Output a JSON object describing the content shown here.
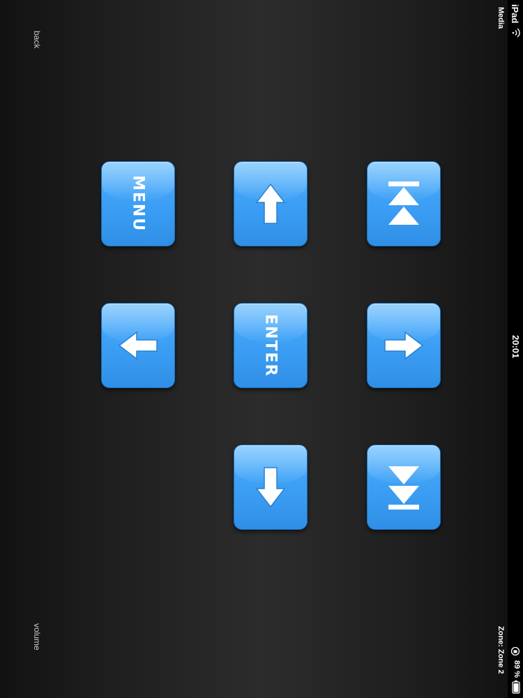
{
  "status_bar": {
    "device": "iPad",
    "time": "20:01",
    "battery": "89 %"
  },
  "header": {
    "title": "Media",
    "zone": "Zone: Zone 2"
  },
  "nav": {
    "back": "back",
    "volume": "volume"
  },
  "remote": {
    "menu_label": "MENU",
    "enter_label": "ENTER",
    "up_icon": "arrow-up-icon",
    "left_icon": "arrow-left-icon",
    "right_icon": "arrow-right-icon",
    "down_icon": "arrow-down-icon",
    "skip_back_icon": "skip-previous-icon",
    "skip_forward_icon": "skip-next-icon"
  },
  "colors": {
    "button_blue": "#3fa2f7",
    "background": "#1e1e1e",
    "icon": "#ffffff"
  }
}
